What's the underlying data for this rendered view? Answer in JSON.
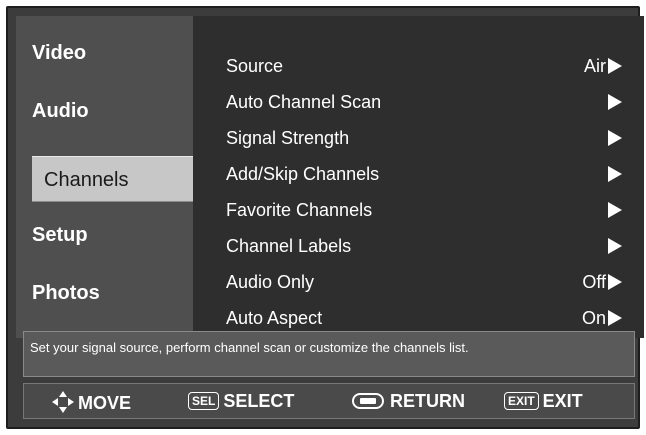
{
  "sidebar": {
    "items": [
      {
        "label": "Video",
        "selected": false
      },
      {
        "label": "Audio",
        "selected": false
      },
      {
        "label": "Channels",
        "selected": true
      },
      {
        "label": "Setup",
        "selected": false
      },
      {
        "label": "Photos",
        "selected": false
      }
    ]
  },
  "menu": {
    "rows": [
      {
        "label": "Source",
        "value": "Air"
      },
      {
        "label": "Auto Channel Scan",
        "value": ""
      },
      {
        "label": "Signal Strength",
        "value": ""
      },
      {
        "label": "Add/Skip Channels",
        "value": ""
      },
      {
        "label": "Favorite Channels",
        "value": ""
      },
      {
        "label": "Channel Labels",
        "value": ""
      },
      {
        "label": "Audio Only",
        "value": "Off"
      },
      {
        "label": "Auto Aspect",
        "value": "On"
      }
    ]
  },
  "help": {
    "text": "Set your signal source, perform channel scan or customize the channels list."
  },
  "footer": {
    "move_label": "MOVE",
    "select_key": "SEL",
    "select_label": "SELECT",
    "return_label": "RETURN",
    "exit_key": "EXIT",
    "exit_label": "EXIT"
  },
  "colors": {
    "frame": "#3c3c3c",
    "sidebar": "#4f4f4f",
    "selected_item": "#c7c7c7",
    "panel": "#2e2e2e",
    "text": "#ffffff"
  }
}
